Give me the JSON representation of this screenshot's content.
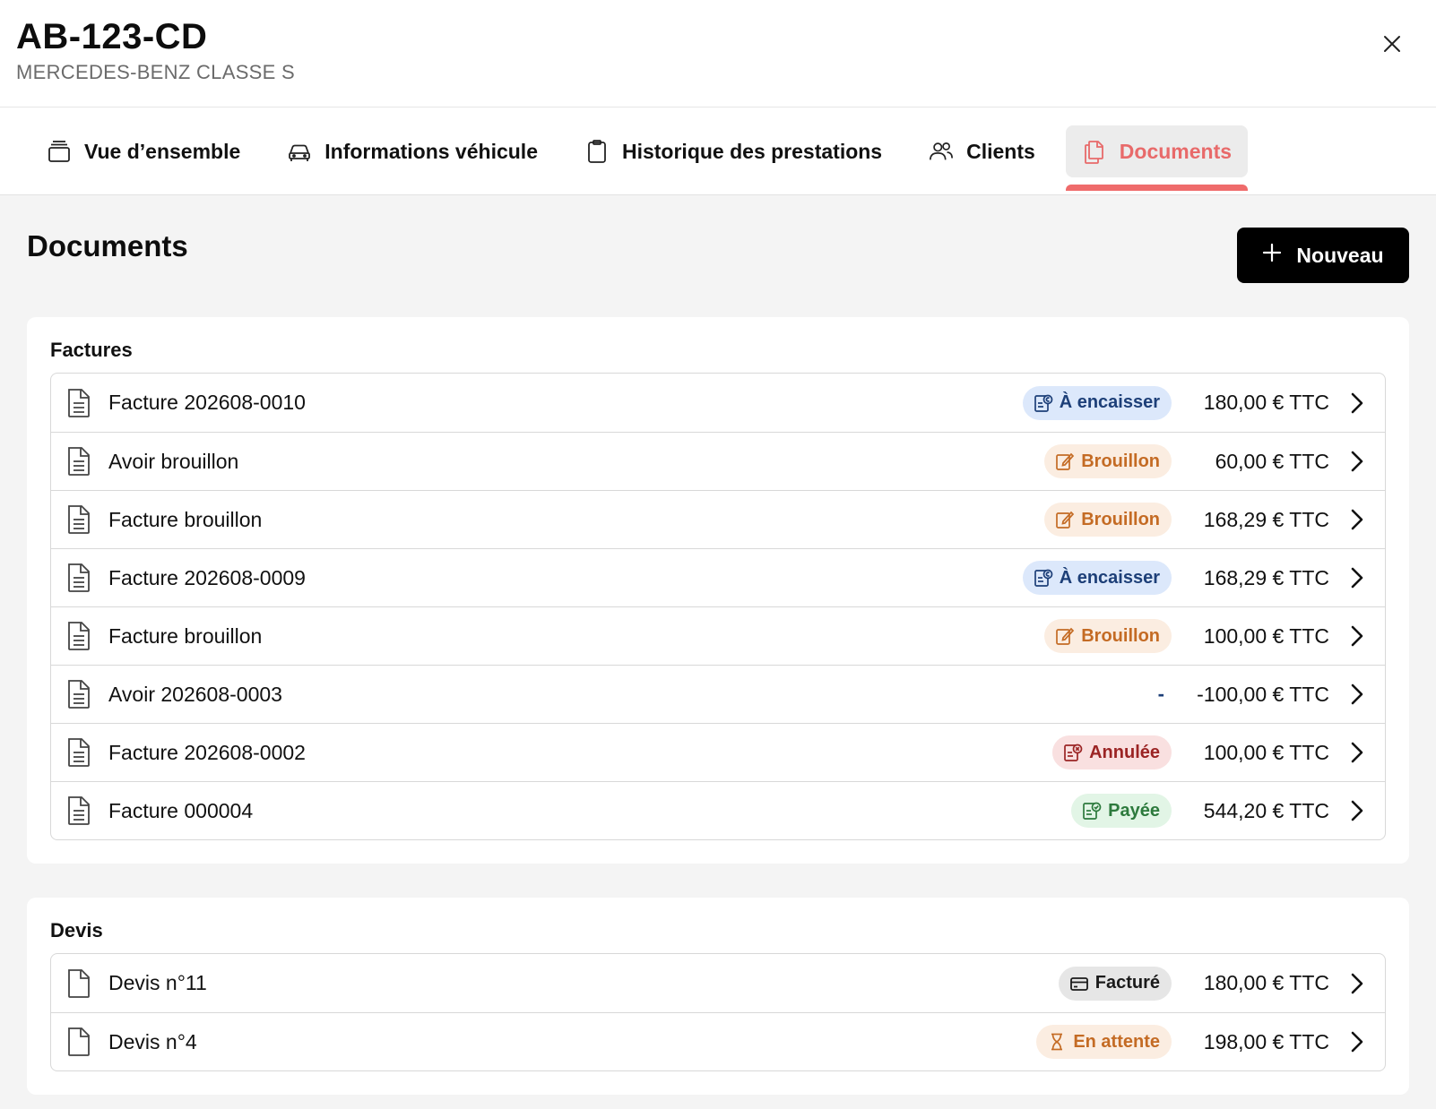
{
  "header": {
    "plate": "AB-123-CD",
    "model": "MERCEDES-BENZ CLASSE S"
  },
  "tabs": [
    {
      "label": "Vue d’ensemble",
      "icon": "stack-icon"
    },
    {
      "label": "Informations véhicule",
      "icon": "car-icon"
    },
    {
      "label": "Historique des prestations",
      "icon": "clipboard-icon"
    },
    {
      "label": "Clients",
      "icon": "users-icon"
    },
    {
      "label": "Documents",
      "icon": "documents-icon",
      "active": true
    }
  ],
  "main": {
    "title": "Documents",
    "new_button": "Nouveau"
  },
  "factures": {
    "title": "Factures",
    "rows": [
      {
        "name": "Facture 202608-0010",
        "status": "À encaisser",
        "amount": "180,00 € TTC"
      },
      {
        "name": "Avoir brouillon",
        "status": "Brouillon",
        "amount": "60,00 € TTC"
      },
      {
        "name": "Facture brouillon",
        "status": "Brouillon",
        "amount": "168,29 € TTC"
      },
      {
        "name": "Facture 202608-0009",
        "status": "À encaisser",
        "amount": "168,29 € TTC"
      },
      {
        "name": "Facture brouillon",
        "status": "Brouillon",
        "amount": "100,00 € TTC"
      },
      {
        "name": "Avoir 202608-0003",
        "status": "-",
        "amount": "-100,00 € TTC"
      },
      {
        "name": "Facture 202608-0002",
        "status": "Annulée",
        "amount": "100,00 € TTC"
      },
      {
        "name": "Facture 000004",
        "status": "Payée",
        "amount": "544,20 € TTC"
      }
    ]
  },
  "devis": {
    "title": "Devis",
    "rows": [
      {
        "name": "Devis n°11",
        "status": "Facturé",
        "amount": "180,00 € TTC"
      },
      {
        "name": "Devis n°4",
        "status": "En attente",
        "amount": "198,00 € TTC"
      }
    ]
  },
  "colors": {
    "accent": "#ef6b6b",
    "badge_blue_bg": "#dce8fb",
    "badge_orange_bg": "#fbede1",
    "badge_red_bg": "#f9e0e0",
    "badge_green_bg": "#e2f5e6",
    "badge_gray_bg": "#e6e6e6"
  }
}
